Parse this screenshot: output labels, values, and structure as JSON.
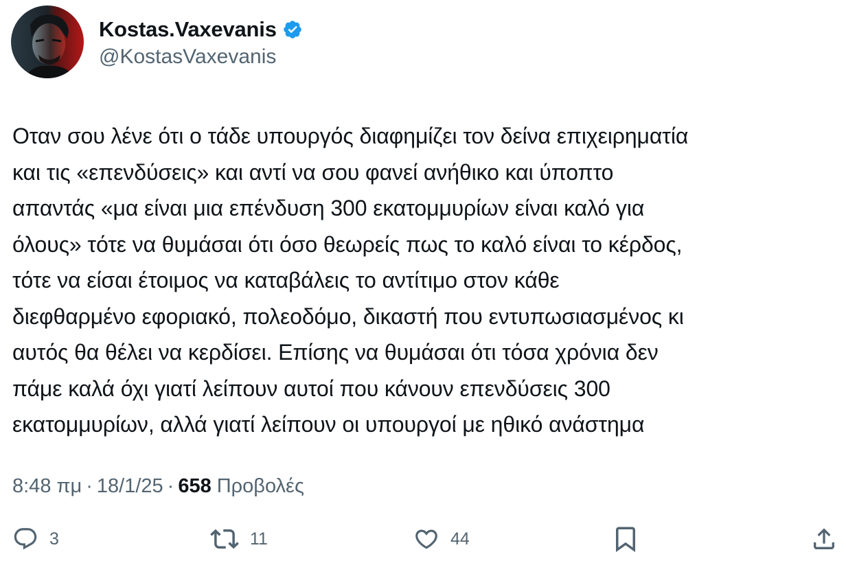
{
  "author": {
    "display_name": "Kostas.Vaxevanis",
    "handle": "@KostasVaxevanis",
    "verified": true,
    "verified_color": "#1d9bf0"
  },
  "tweet": {
    "lines": [
      "Οταν σου λένε ότι ο τάδε υπουργός διαφημίζει τον δείνα επιχειρηματία",
      "και τις «επενδύσεις» και αντί να σου φανεί ανήθικο και ύποπτο",
      "απαντάς «μα είναι μια επένδυση 300 εκατομμυρίων είναι καλό για",
      "όλους» τότε να θυμάσαι ότι όσο θεωρείς πως το καλό είναι το κέρδος,",
      "τότε να είσαι έτοιμος να καταβάλεις το αντίτιμο στον κάθε",
      "διεφθαρμένο εφοριακό, πολεοδόμο, δικαστή που εντυπωσιασμένος κι",
      "αυτός θα θέλει να κερδίσει. Επίσης να θυμάσαι ότι τόσα χρόνια δεν",
      "πάμε καλά όχι γιατί λείπουν αυτοί που κάνουν επενδύσεις 300",
      "εκατομμυρίων, αλλά γιατί λείπουν οι υπουργοί με ηθικό ανάστημα"
    ]
  },
  "meta": {
    "time": "8:48 πμ",
    "separator": "·",
    "date": "18/1/25",
    "views_count": "658",
    "views_label": "Προβολές"
  },
  "actions": {
    "replies": "3",
    "reposts": "11",
    "likes": "44",
    "icon_color": "#536471"
  }
}
